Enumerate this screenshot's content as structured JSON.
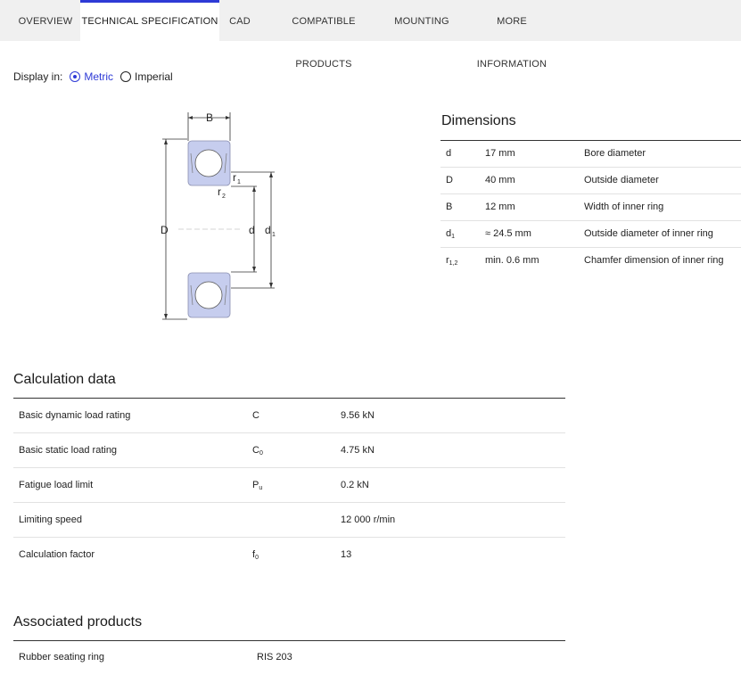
{
  "tabs": [
    {
      "label": "OVERVIEW"
    },
    {
      "label": "TECHNICAL SPECIFICATION"
    },
    {
      "label": "CAD"
    },
    {
      "label": "COMPATIBLE PRODUCTS"
    },
    {
      "label": "MOUNTING"
    },
    {
      "label": "MORE INFORMATION"
    }
  ],
  "active_tab": "TECHNICAL SPECIFICATION",
  "display": {
    "label": "Display in:",
    "metric": "Metric",
    "imperial": "Imperial",
    "selected": "Metric"
  },
  "diagram": {
    "B": "B",
    "D": "D",
    "d": "d",
    "d1": "d",
    "d1_sub": "1",
    "r1": "r",
    "r1_sub": "1",
    "r2": "r",
    "r2_sub": "2"
  },
  "dimensions": {
    "title": "Dimensions",
    "rows": [
      {
        "sym": "d",
        "sub": "",
        "value": "17 mm",
        "desc": "Bore diameter"
      },
      {
        "sym": "D",
        "sub": "",
        "value": "40 mm",
        "desc": "Outside diameter"
      },
      {
        "sym": "B",
        "sub": "",
        "value": "12 mm",
        "desc": "Width of inner ring"
      },
      {
        "sym": "d",
        "sub": "1",
        "value": "≈ 24.5 mm",
        "desc": "Outside diameter of inner ring"
      },
      {
        "sym": "r",
        "sub": "1,2",
        "value": "min. 0.6 mm",
        "desc": "Chamfer dimension of inner ring"
      }
    ]
  },
  "calculation": {
    "title": "Calculation data",
    "rows": [
      {
        "label": "Basic dynamic load rating",
        "sym": "C",
        "sub": "",
        "value": "9.56 kN"
      },
      {
        "label": "Basic static load rating",
        "sym": "C",
        "sub": "0",
        "value": "4.75 kN"
      },
      {
        "label": "Fatigue load limit",
        "sym": "P",
        "sub": "u",
        "value": "0.2 kN"
      },
      {
        "label": "Limiting speed",
        "sym": "",
        "sub": "",
        "value": "12 000 r/min"
      },
      {
        "label": "Calculation factor",
        "sym": "f",
        "sub": "0",
        "value": "13"
      }
    ]
  },
  "associated": {
    "title": "Associated products",
    "rows": [
      {
        "label": "Rubber seating ring",
        "value": "RIS 203"
      }
    ]
  },
  "colors": {
    "accent": "#2e3ad6",
    "ring_fill": "#c6cdee",
    "ring_stroke": "#8a8fb0"
  }
}
